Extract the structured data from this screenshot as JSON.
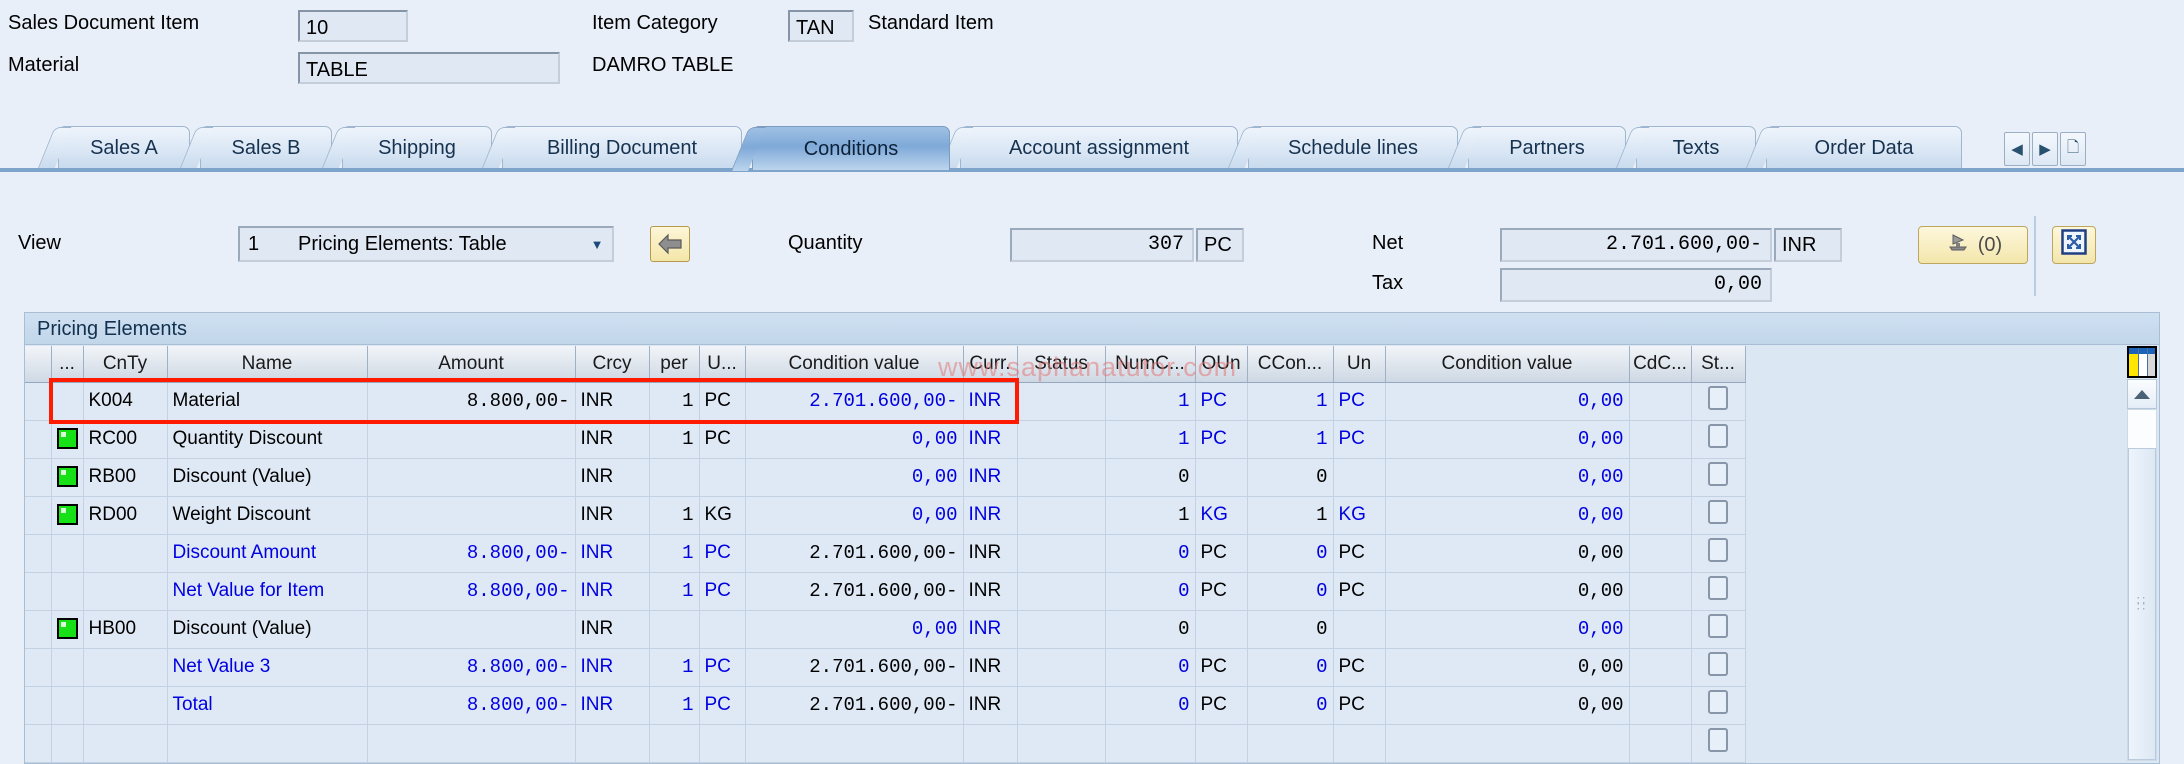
{
  "header": {
    "sales_document_item_label": "Sales Document Item",
    "sales_document_item_value": "10",
    "item_category_label": "Item Category",
    "item_category_value": "TAN",
    "item_category_text": "Standard Item",
    "material_label": "Material",
    "material_value": "TABLE",
    "material_text": "DAMRO TABLE"
  },
  "tabs": {
    "items": [
      {
        "label": "Sales A",
        "selected": false
      },
      {
        "label": "Sales B",
        "selected": false
      },
      {
        "label": "Shipping",
        "selected": false
      },
      {
        "label": "Billing Document",
        "selected": false
      },
      {
        "label": "Conditions",
        "selected": true
      },
      {
        "label": "Account assignment",
        "selected": false
      },
      {
        "label": "Schedule lines",
        "selected": false
      },
      {
        "label": "Partners",
        "selected": false
      },
      {
        "label": "Texts",
        "selected": false
      },
      {
        "label": "Order Data",
        "selected": false
      }
    ],
    "nav": {
      "prev_icon": "chevron-left-icon",
      "next_icon": "chevron-right-icon",
      "list_icon": "tab-list-icon"
    }
  },
  "toolbar": {
    "view_label": "View",
    "view_key": "1",
    "view_text": "Pricing Elements: Table",
    "dropdown_icon": "chevron-down-icon",
    "back_icon": "back-arrow-icon",
    "quantity_label": "Quantity",
    "quantity_value": "307",
    "quantity_unit": "PC",
    "net_label": "Net",
    "net_value": "2.701.600,00-",
    "net_currency": "INR",
    "tax_label": "Tax",
    "tax_value": "0,00",
    "analysis_button_label": "(0)",
    "analysis_icon": "pricing-analysis-icon",
    "fullscreen_icon": "expand-icon"
  },
  "grid": {
    "caption": "Pricing Elements",
    "columns": [
      "",
      "...",
      "CnTy",
      "Name",
      "Amount",
      "Crcy",
      "per",
      "U...",
      "Condition value",
      "Curr.",
      "Status",
      "NumC...",
      "OUn",
      "CCon...",
      "Un",
      "Condition value",
      "CdC...",
      "St..."
    ],
    "config_icon": "table-settings-icon",
    "scroll_up_icon": "scroll-up-icon",
    "rows": [
      {
        "strip": true,
        "status": "",
        "cnty": "K004",
        "name": "Material",
        "name_color": "black",
        "amount": "8.800,00-",
        "amount_color": "black",
        "amount_white": true,
        "crcy": "INR",
        "crcy_color": "black",
        "per": "1",
        "per_color": "black",
        "per_white": true,
        "uom": "PC",
        "uom_color": "black",
        "uom_white": true,
        "condval": "2.701.600,00-",
        "condval_color": "blue",
        "curr": "INR",
        "curr_color": "blue",
        "numc": "1",
        "numc_color": "blue",
        "numc_white": false,
        "oun": "PC",
        "oun_color": "blue",
        "ccon": "1",
        "ccon_color": "blue",
        "ccon_white": false,
        "un": "PC",
        "un_color": "blue",
        "condval2": "0,00",
        "condval2_color": "blue",
        "cdc": "",
        "checkbox": true
      },
      {
        "strip": true,
        "status": "green",
        "cnty": "RC00",
        "name": "Quantity Discount",
        "name_color": "black",
        "amount": "",
        "amount_color": "black",
        "amount_white": true,
        "crcy": "INR",
        "crcy_color": "black",
        "per": "1",
        "per_color": "black",
        "per_white": true,
        "uom": "PC",
        "uom_color": "black",
        "uom_white": true,
        "condval": "0,00",
        "condval_color": "blue",
        "curr": "INR",
        "curr_color": "blue",
        "numc": "1",
        "numc_color": "blue",
        "numc_white": true,
        "oun": "PC",
        "oun_color": "blue",
        "ccon": "1",
        "ccon_color": "blue",
        "ccon_white": true,
        "un": "PC",
        "un_color": "blue",
        "condval2": "0,00",
        "condval2_color": "blue",
        "cdc": "",
        "checkbox": true
      },
      {
        "strip": true,
        "status": "green",
        "cnty": "RB00",
        "name": "Discount (Value)",
        "name_color": "black",
        "amount": "",
        "amount_color": "black",
        "amount_white": true,
        "crcy": "INR",
        "crcy_color": "black",
        "per": "",
        "per_color": "black",
        "per_white": false,
        "uom": "",
        "uom_color": "black",
        "uom_white": false,
        "condval": "0,00",
        "condval_color": "blue",
        "curr": "INR",
        "curr_color": "blue",
        "numc": "0",
        "numc_color": "black",
        "numc_white": false,
        "oun": "",
        "oun_color": "black",
        "ccon": "0",
        "ccon_color": "black",
        "ccon_white": false,
        "un": "",
        "un_color": "black",
        "condval2": "0,00",
        "condval2_color": "blue",
        "cdc": "",
        "checkbox": true
      },
      {
        "strip": true,
        "status": "green",
        "cnty": "RD00",
        "name": "Weight Discount",
        "name_color": "black",
        "amount": "",
        "amount_color": "black",
        "amount_white": true,
        "crcy": "INR",
        "crcy_color": "black",
        "per": "1",
        "per_color": "black",
        "per_white": true,
        "uom": "KG",
        "uom_color": "black",
        "uom_white": true,
        "condval": "0,00",
        "condval_color": "blue",
        "curr": "INR",
        "curr_color": "blue",
        "numc": "1",
        "numc_color": "black",
        "numc_white": false,
        "oun": "KG",
        "oun_color": "blue",
        "ccon": "1",
        "ccon_color": "black",
        "ccon_white": false,
        "un": "KG",
        "un_color": "blue",
        "condval2": "0,00",
        "condval2_color": "blue",
        "cdc": "",
        "checkbox": true
      },
      {
        "strip": false,
        "status": "",
        "cnty": "",
        "name": "Discount Amount",
        "name_color": "blue",
        "amount": "8.800,00-",
        "amount_color": "blue",
        "amount_white": false,
        "crcy": "INR",
        "crcy_color": "blue",
        "per": "1",
        "per_color": "blue",
        "per_white": false,
        "uom": "PC",
        "uom_color": "blue",
        "uom_white": false,
        "condval": "2.701.600,00-",
        "condval_color": "black",
        "curr": "INR",
        "curr_color": "black",
        "numc": "0",
        "numc_color": "blue",
        "numc_white": false,
        "oun": "PC",
        "oun_color": "black",
        "ccon": "0",
        "ccon_color": "blue",
        "ccon_white": false,
        "un": "PC",
        "un_color": "black",
        "condval2": "0,00",
        "condval2_color": "black",
        "cdc": "",
        "checkbox": true
      },
      {
        "strip": false,
        "status": "",
        "cnty": "",
        "name": "Net Value for Item",
        "name_color": "blue",
        "amount": "8.800,00-",
        "amount_color": "blue",
        "amount_white": false,
        "crcy": "INR",
        "crcy_color": "blue",
        "per": "1",
        "per_color": "blue",
        "per_white": false,
        "uom": "PC",
        "uom_color": "blue",
        "uom_white": false,
        "condval": "2.701.600,00-",
        "condval_color": "black",
        "curr": "INR",
        "curr_color": "black",
        "numc": "0",
        "numc_color": "blue",
        "numc_white": false,
        "oun": "PC",
        "oun_color": "black",
        "ccon": "0",
        "ccon_color": "blue",
        "ccon_white": false,
        "un": "PC",
        "un_color": "black",
        "condval2": "0,00",
        "condval2_color": "black",
        "cdc": "",
        "checkbox": true
      },
      {
        "strip": true,
        "status": "green",
        "cnty": "HB00",
        "name": "Discount (Value)",
        "name_color": "black",
        "amount": "",
        "amount_color": "black",
        "amount_white": true,
        "crcy": "INR",
        "crcy_color": "black",
        "per": "",
        "per_color": "black",
        "per_white": false,
        "uom": "",
        "uom_color": "black",
        "uom_white": false,
        "condval": "0,00",
        "condval_color": "blue",
        "curr": "INR",
        "curr_color": "blue",
        "numc": "0",
        "numc_color": "black",
        "numc_white": false,
        "oun": "",
        "oun_color": "black",
        "ccon": "0",
        "ccon_color": "black",
        "ccon_white": false,
        "un": "",
        "un_color": "black",
        "condval2": "0,00",
        "condval2_color": "blue",
        "cdc": "",
        "checkbox": true
      },
      {
        "strip": false,
        "status": "",
        "cnty": "",
        "name": "Net Value 3",
        "name_color": "blue",
        "amount": "8.800,00-",
        "amount_color": "blue",
        "amount_white": false,
        "crcy": "INR",
        "crcy_color": "blue",
        "per": "1",
        "per_color": "blue",
        "per_white": false,
        "uom": "PC",
        "uom_color": "blue",
        "uom_white": false,
        "condval": "2.701.600,00-",
        "condval_color": "black",
        "curr": "INR",
        "curr_color": "black",
        "numc": "0",
        "numc_color": "blue",
        "numc_white": false,
        "oun": "PC",
        "oun_color": "black",
        "ccon": "0",
        "ccon_color": "blue",
        "ccon_white": false,
        "un": "PC",
        "un_color": "black",
        "condval2": "0,00",
        "condval2_color": "black",
        "cdc": "",
        "checkbox": true
      },
      {
        "strip": false,
        "status": "",
        "cnty": "",
        "name": "Total",
        "name_color": "blue",
        "amount": "8.800,00-",
        "amount_color": "blue",
        "amount_white": false,
        "crcy": "INR",
        "crcy_color": "blue",
        "per": "1",
        "per_color": "blue",
        "per_white": false,
        "uom": "PC",
        "uom_color": "blue",
        "uom_white": false,
        "condval": "2.701.600,00-",
        "condval_color": "black",
        "curr": "INR",
        "curr_color": "black",
        "numc": "0",
        "numc_color": "blue",
        "numc_white": false,
        "oun": "PC",
        "oun_color": "black",
        "ccon": "0",
        "ccon_color": "blue",
        "ccon_white": false,
        "un": "PC",
        "un_color": "black",
        "condval2": "0,00",
        "condval2_color": "black",
        "cdc": "",
        "checkbox": true
      },
      {
        "strip": false,
        "status": "",
        "cnty": "",
        "name": "",
        "name_color": "black",
        "amount": "",
        "amount_color": "black",
        "amount_white": true,
        "crcy": "",
        "crcy_color": "black",
        "per": "",
        "per_color": "black",
        "per_white": true,
        "uom": "",
        "uom_color": "black",
        "uom_white": true,
        "condval": "",
        "condval_color": "black",
        "curr": "",
        "curr_color": "black",
        "numc": "",
        "numc_color": "black",
        "numc_white": true,
        "oun": "",
        "oun_color": "black",
        "ccon": "",
        "ccon_color": "black",
        "ccon_white": true,
        "un": "",
        "un_color": "black",
        "condval2": "",
        "condval2_color": "black",
        "cdc": "",
        "checkbox": true,
        "blank": true
      }
    ]
  },
  "watermark": {
    "text": "www.saphanatutor.com"
  },
  "colors": {
    "page_background": "#e8eff8",
    "accent_blue": "#0000e0",
    "highlight_red": "#ff1a00",
    "status_green": "#16e016",
    "tab_selected": "#7fa9d8"
  }
}
